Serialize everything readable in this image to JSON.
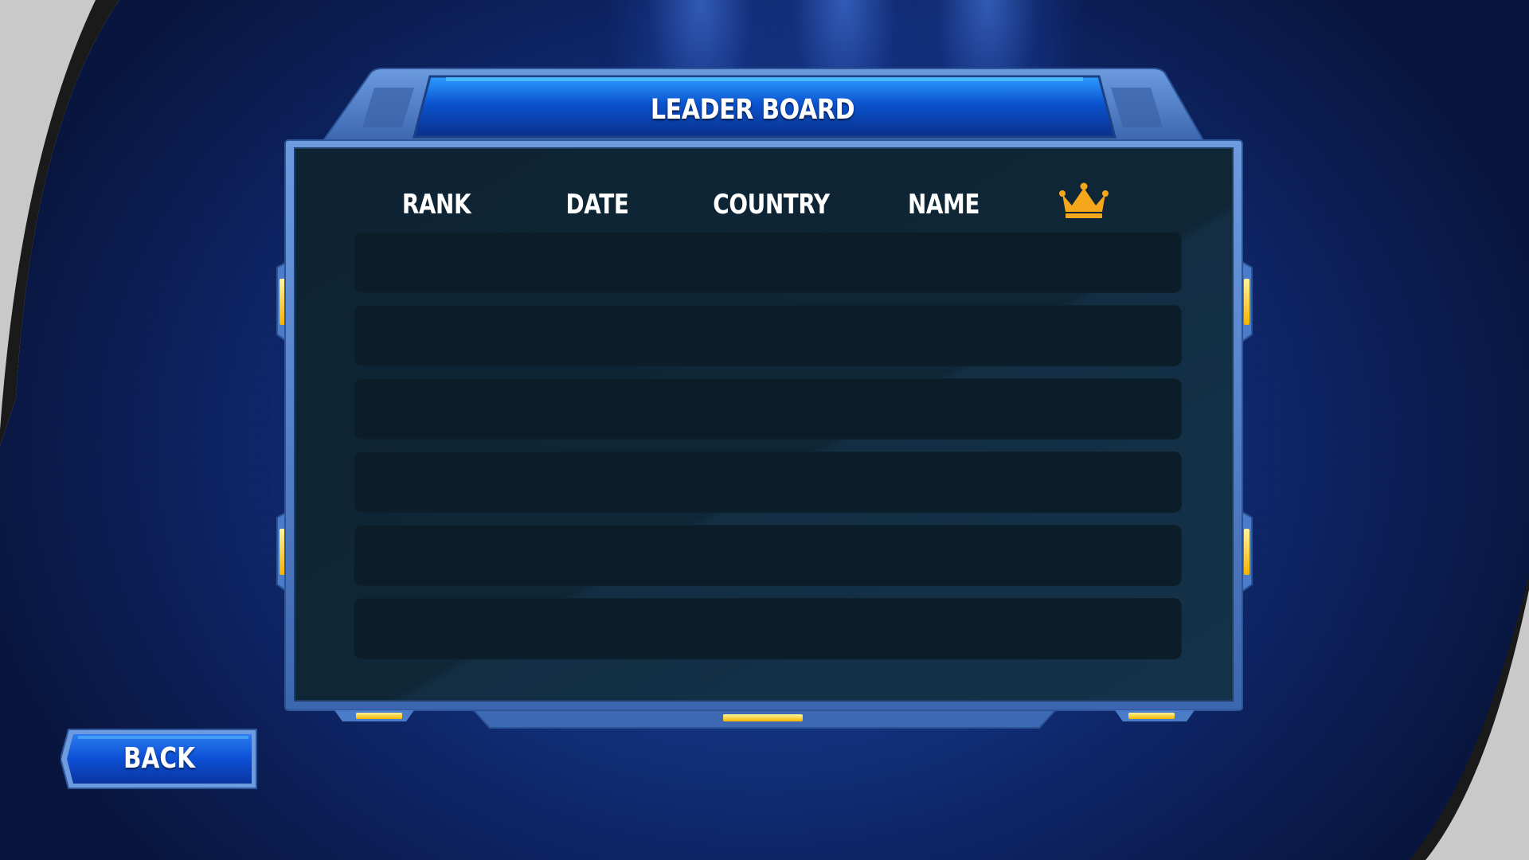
{
  "panel": {
    "title": "LEADER BOARD"
  },
  "columns": [
    {
      "label": "RANK"
    },
    {
      "label": "DATE"
    },
    {
      "label": "COUNTRY"
    },
    {
      "label": "NAME"
    },
    {
      "label": "",
      "icon": "crown-icon"
    }
  ],
  "rows": [
    {
      "rank": "",
      "date": "",
      "country": "",
      "name": "",
      "score": ""
    },
    {
      "rank": "",
      "date": "",
      "country": "",
      "name": "",
      "score": ""
    },
    {
      "rank": "",
      "date": "",
      "country": "",
      "name": "",
      "score": ""
    },
    {
      "rank": "",
      "date": "",
      "country": "",
      "name": "",
      "score": ""
    },
    {
      "rank": "",
      "date": "",
      "country": "",
      "name": "",
      "score": ""
    },
    {
      "rank": "",
      "date": "",
      "country": "",
      "name": "",
      "score": ""
    }
  ],
  "back_button": {
    "label": "BACK"
  },
  "colors": {
    "background": "#133483",
    "panel_fill": "#10283a",
    "frame_blue": "#4b7cc9",
    "row_fill": "#0c1d2a",
    "accent_yellow": "#ffd21f",
    "crown_gold": "#f5a71b"
  }
}
